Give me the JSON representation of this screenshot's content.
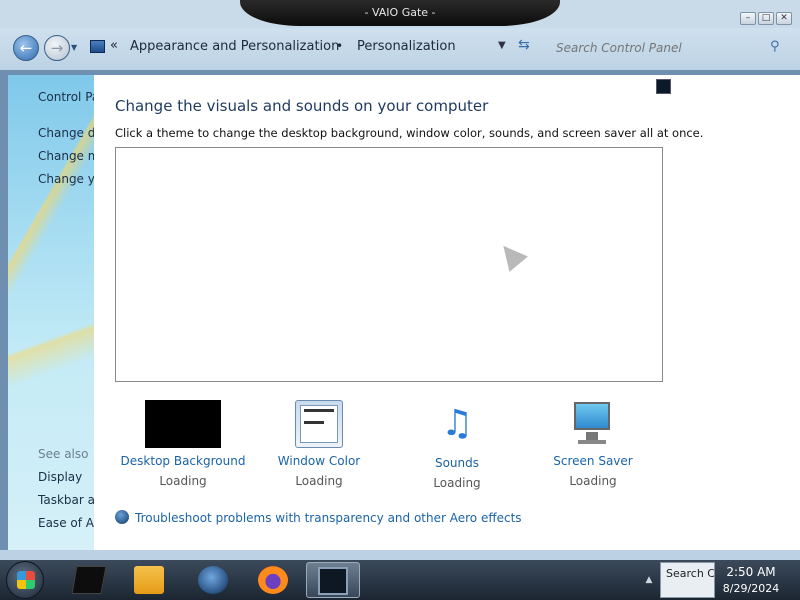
{
  "window": {
    "title": "- VAIO Gate -",
    "minimize": "–",
    "maximize": "□",
    "close": "✕"
  },
  "address": {
    "crumb_overflow": "«",
    "crumbs": [
      "Appearance and Personalization",
      "Personalization"
    ],
    "crumb_separator": "•",
    "search_placeholder": "Search Control Panel"
  },
  "sidebar": {
    "home": "Control Panel Home",
    "links": [
      "Change desktop icons",
      "Change mouse pointers",
      "Change your account picture"
    ],
    "see_also": "See also",
    "see_also_links": [
      "Display",
      "Taskbar and Start Menu",
      "Ease of Access Center"
    ]
  },
  "main": {
    "title": "Change the visuals and sounds on your computer",
    "subtitle": "Click a theme to change the desktop background, window color, sounds, and screen saver all at once.",
    "tiles": [
      {
        "label": "Desktop Background",
        "status": "Loading"
      },
      {
        "label": "Window Color",
        "status": "Loading"
      },
      {
        "label": "Sounds",
        "status": "Loading"
      },
      {
        "label": "Screen Saver",
        "status": "Loading"
      }
    ],
    "troubleshoot": "Troubleshoot problems with transparency and other Aero effects"
  },
  "taskbar": {
    "tray_search": "Search Co",
    "time": "2:50 AM",
    "date": "8/29/2024"
  }
}
